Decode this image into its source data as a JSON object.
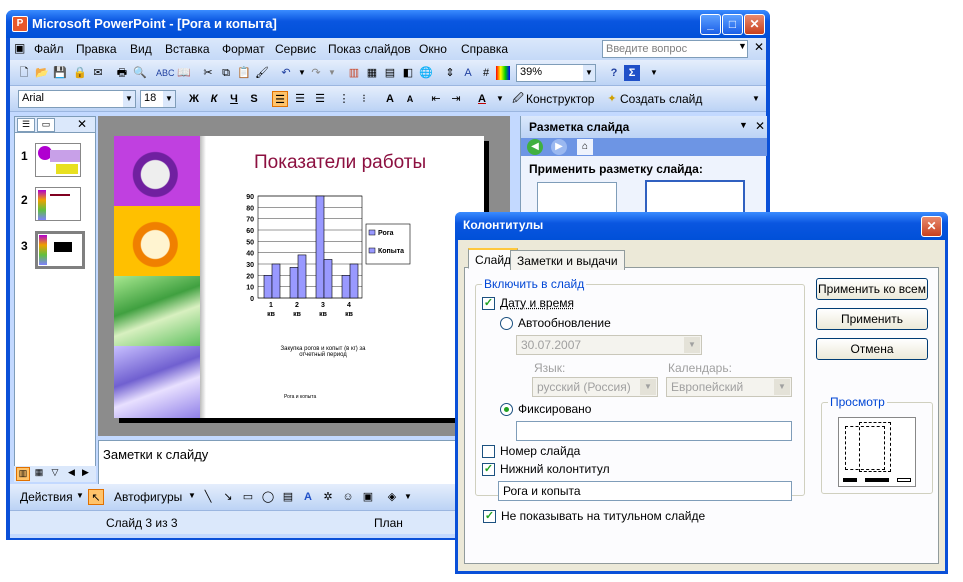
{
  "window": {
    "title": "Microsoft PowerPoint - [Рога и копыта]",
    "min": "_",
    "max": "□",
    "close": "✕"
  },
  "menu": {
    "items": [
      "Файл",
      "Правка",
      "Вид",
      "Вставка",
      "Формат",
      "Сервис",
      "Показ слайдов",
      "Окно",
      "Справка"
    ],
    "ask_placeholder": "Введите вопрос"
  },
  "toolbar": {
    "zoom": "39%",
    "font": "Arial",
    "size": "18",
    "bold": "Ж",
    "italic": "К",
    "underline": "Ч",
    "shadow": "S",
    "designer": "Конструктор",
    "new_slide": "Создать слайд"
  },
  "slides_panel": {
    "numbers": [
      "1",
      "2",
      "3"
    ],
    "close": "✕"
  },
  "slide": {
    "title": "Показатели работы",
    "caption": "Закупка рогов и копыт (в кг) за отчетный период",
    "footer": "Рога и копыта"
  },
  "chart_data": {
    "type": "bar",
    "categories": [
      "1 кв",
      "2 кв",
      "3 кв",
      "4 кв"
    ],
    "series": [
      {
        "name": "Рога",
        "values": [
          20,
          27,
          90,
          20
        ]
      },
      {
        "name": "Копыта",
        "values": [
          30,
          38,
          34,
          30
        ]
      }
    ],
    "yticks": [
      "90",
      "80",
      "70",
      "60",
      "50",
      "40",
      "30",
      "20",
      "10",
      "0"
    ],
    "ylim": [
      0,
      90
    ],
    "legend": "right"
  },
  "notes": {
    "text": "Заметки к слайду"
  },
  "taskpane": {
    "title": "Разметка слайда",
    "apply_label": "Применить разметку слайда:"
  },
  "drawbar": {
    "actions": "Действия",
    "autoshapes": "Автофигуры"
  },
  "status": {
    "slide": "Слайд 3 из 3",
    "design": "План"
  },
  "dialog": {
    "title": "Колонтитулы",
    "tabs": [
      "Слайд",
      "Заметки и выдачи"
    ],
    "group_label": "Включить в слайд",
    "date_time": "Дату и время",
    "auto_update": "Автообновление",
    "auto_date": "30.07.2007",
    "lang_label": "Язык:",
    "lang_value": "русский (Россия)",
    "cal_label": "Календарь:",
    "cal_value": "Европейский",
    "fixed": "Фиксировано",
    "fixed_value": "",
    "slide_number": "Номер слайда",
    "footer": "Нижний колонтитул",
    "footer_value": "Рога и копыта",
    "no_title": "Не показывать на титульном слайде",
    "btn_apply_all": "Применить ко всем",
    "btn_apply": "Применить",
    "btn_cancel": "Отмена",
    "preview": "Просмотр",
    "close": "✕"
  }
}
